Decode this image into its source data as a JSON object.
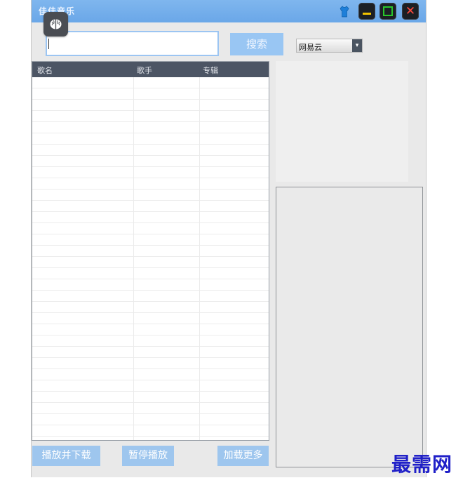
{
  "window": {
    "title": "佳佳音乐",
    "icons": {
      "skin": "tshirt-icon",
      "minimize": "minimize-icon",
      "maximize": "maximize-icon",
      "close": "close-icon"
    },
    "colors": {
      "titlebar": "#6fa9e9",
      "close": "#ff4a3d",
      "minimize": "#f2c200",
      "maximize": "#29c62b"
    }
  },
  "search": {
    "value": "",
    "button_label": "搜索"
  },
  "source": {
    "selected": "网易云",
    "arrow": "▾"
  },
  "table": {
    "columns": [
      "歌名",
      "歌手",
      "专辑"
    ],
    "rows": []
  },
  "buttons": {
    "play_download": "播放并下载",
    "pause": "暂停播放",
    "load_more": "加载更多"
  },
  "overlay": {
    "assistant_icon": "brain-icon"
  },
  "watermark": "最需网"
}
